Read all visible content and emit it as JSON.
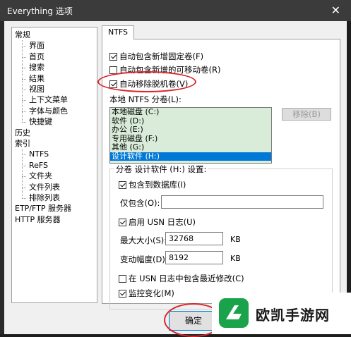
{
  "window": {
    "title": "Everything 选项",
    "close_glyph": "✕"
  },
  "tree": {
    "items": [
      {
        "label": "常规",
        "level": 0
      },
      {
        "label": "界面",
        "level": 1
      },
      {
        "label": "首页",
        "level": 1
      },
      {
        "label": "搜索",
        "level": 1
      },
      {
        "label": "结果",
        "level": 1
      },
      {
        "label": "视图",
        "level": 1
      },
      {
        "label": "上下文菜单",
        "level": 1
      },
      {
        "label": "字体与颜色",
        "level": 1
      },
      {
        "label": "快捷键",
        "level": 1
      },
      {
        "label": "历史",
        "level": 0
      },
      {
        "label": "索引",
        "level": 0
      },
      {
        "label": "NTFS",
        "level": 1
      },
      {
        "label": "ReFS",
        "level": 1
      },
      {
        "label": "文件夹",
        "level": 1
      },
      {
        "label": "文件列表",
        "level": 1
      },
      {
        "label": "排除列表",
        "level": 1
      },
      {
        "label": "ETP/FTP 服务器",
        "level": 0
      },
      {
        "label": "HTTP 服务器",
        "level": 0
      }
    ]
  },
  "tab": {
    "label": "NTFS"
  },
  "options": {
    "auto_include_fixed": {
      "label": "自动包含新增固定卷(F)",
      "checked": true
    },
    "auto_include_removable": {
      "label": "自动包含新增的可移动卷(R)",
      "checked": false
    },
    "auto_remove_offline": {
      "label": "自动移除脱机卷(V)",
      "checked": true
    }
  },
  "volumes": {
    "label": "本地 NTFS 分卷(L):",
    "items": [
      "本地磁盘 (C:)",
      "软件 (D:)",
      "办公 (E:)",
      "专用磁盘 (F:)",
      "其他 (G:)",
      "设计软件 (H:)"
    ],
    "selected_index": 5,
    "remove_button": "移除(B)"
  },
  "volume_settings": {
    "title": "分卷 设计软件 (H:) 设置:",
    "include_in_db": {
      "label": "包含到数据库(I)",
      "checked": true
    },
    "include_only_label": "仅包含(O):",
    "include_only_value": "",
    "enable_usn": {
      "label": "启用 USN 日志(U)",
      "checked": true
    },
    "max_size_label": "最大大小(S):",
    "max_size_value": "32768",
    "max_size_unit": "KB",
    "allocation_delta_label": "变动幅度(D):",
    "allocation_delta_value": "8192",
    "allocation_delta_unit": "KB",
    "include_recent_changes": {
      "label": "在 USN 日志中包含最近修改(C)",
      "checked": false
    },
    "monitor_changes": {
      "label": "监控变化(M)",
      "checked": true
    }
  },
  "footer": {
    "ok_button": "确定"
  },
  "watermark": {
    "text": "欧凯手游网"
  },
  "colors": {
    "highlight": "#d9262c",
    "selection": "#0078d7",
    "list_bg": "#d9ecd9",
    "brand": "#1aa34a"
  }
}
